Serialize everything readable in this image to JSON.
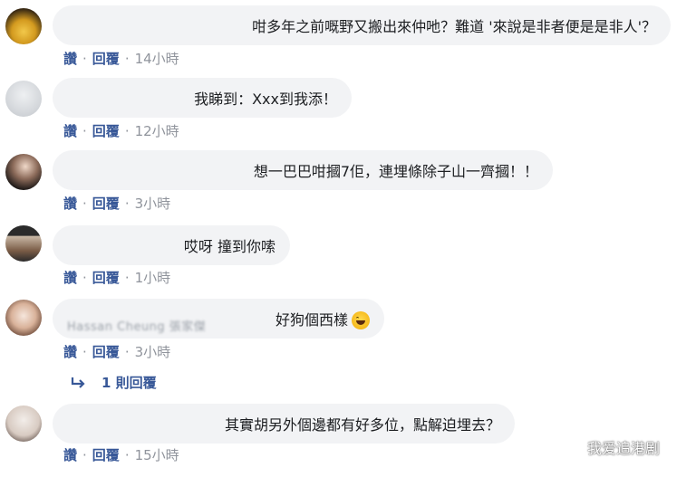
{
  "comments": [
    {
      "text": "咁多年之前嘅野又搬出來仲吔？難道 '來說是非者便是是非人'？",
      "actions": {
        "like": "讚",
        "reply": "回覆",
        "time": "14小時"
      }
    },
    {
      "text": "我睇到：Xxx到我添！",
      "actions": {
        "like": "讚",
        "reply": "回覆",
        "time": "12小時"
      }
    },
    {
      "text": "想一巴巴咁摑7佢，連埋條除子山一齊摑！！",
      "actions": {
        "like": "讚",
        "reply": "回覆",
        "time": "3小時"
      }
    },
    {
      "text": "哎呀 撞到你嗦",
      "actions": {
        "like": "讚",
        "reply": "回覆",
        "time": "1小時"
      }
    },
    {
      "name_obscured": "Hassan Cheung 張家傑",
      "text": "好狗個西樣",
      "emoji": "grinning-sweat-emoji",
      "actions": {
        "like": "讚",
        "reply": "回覆",
        "time": "3小時"
      },
      "replies_label": "1 則回覆"
    },
    {
      "text": "其實胡另外個邊都有好多位，點解迫埋去？",
      "actions": {
        "like": "讚",
        "reply": "回覆",
        "time": "15小時"
      }
    }
  ],
  "separator": "·",
  "watermark": {
    "text": "我爱追港剧",
    "icon": "wechat-icon"
  },
  "colors": {
    "bubble": "#f2f3f5",
    "link": "#385898",
    "meta": "#90949c",
    "text": "#1c1e21"
  }
}
